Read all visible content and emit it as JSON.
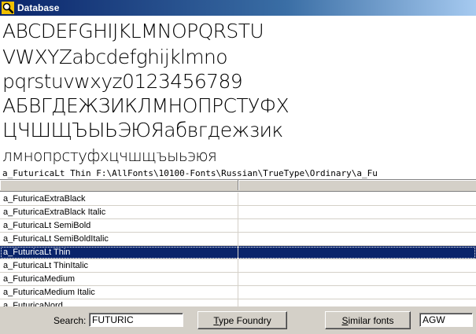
{
  "window": {
    "title": "Database",
    "icon": "magnifier-icon"
  },
  "preview": {
    "lines": [
      "ABCDEFGHIJKLMNOPQRSTU",
      "VWXYZabcdefghijklmno",
      "pqrstuvwxyz0123456789",
      "АБВГДЕЖЗИКЛМНОПРСТУФХ",
      "ЦЧШЩЪЫЬЭЮЯабвгдежзик",
      "лмнопрстуфхцчшщъыьэюя"
    ],
    "path": "a_FuturicaLt Thin    F:\\AllFonts\\10100-Fonts\\Russian\\TrueType\\Ordinary\\a_Fu"
  },
  "list": {
    "rows": [
      "a_FuturicaExtraBlack",
      "a_FuturicaExtraBlack Italic",
      "a_FuturicaLt SemiBold",
      "a_FuturicaLt SemiBoldItalic",
      "a_FuturicaLt Thin",
      "a_FuturicaLt ThinItalic",
      "a_FuturicaMedium",
      "a_FuturicaMedium Italic",
      "a_FuturicaNord"
    ],
    "selected_index": 4
  },
  "toolbar": {
    "search_label": "Search:",
    "search_value": "FUTURIC",
    "type_foundry_first": "T",
    "type_foundry_rest": "ype Foundry",
    "similar_first": "S",
    "similar_rest": "imilar fonts",
    "sample_value": "AGW"
  }
}
